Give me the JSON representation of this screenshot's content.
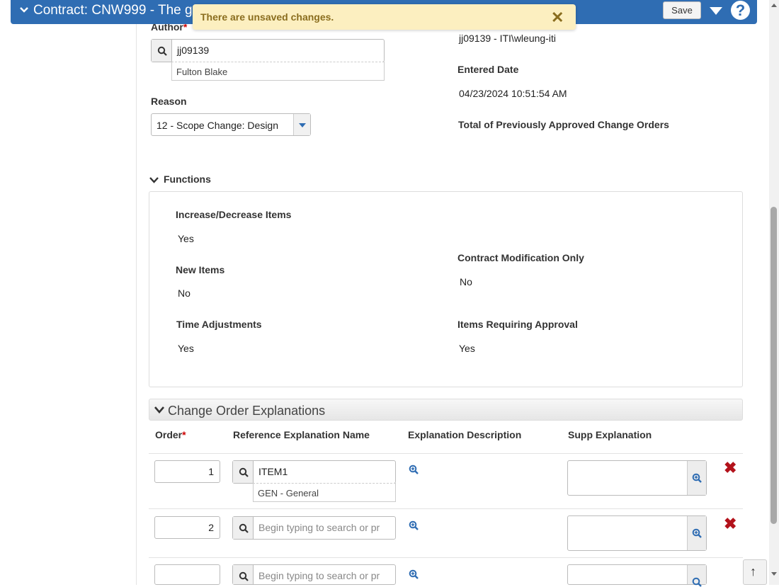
{
  "header": {
    "title": "Contract: CNW999 - The great",
    "save_label": "Save",
    "help_label": "?"
  },
  "toast": {
    "message": "There are unsaved changes.",
    "close": "✕"
  },
  "form": {
    "author_label": "Author",
    "author_value": "jj09139",
    "author_name": "Fulton Blake",
    "user_value": "jj09139 - ITI\\wleung-iti",
    "entered_date_label": "Entered Date",
    "entered_date_value": "04/23/2024 10:51:54 AM",
    "reason_label": "Reason",
    "reason_value": "12 - Scope Change: Design",
    "total_label": "Total of Previously Approved Change Orders"
  },
  "functions": {
    "title": "Functions",
    "increase_label": "Increase/Decrease Items",
    "increase_value": "Yes",
    "new_items_label": "New Items",
    "new_items_value": "No",
    "time_label": "Time Adjustments",
    "time_value": "Yes",
    "contract_mod_label": "Contract Modification Only",
    "contract_mod_value": "No",
    "approval_label": "Items Requiring Approval",
    "approval_value": "Yes"
  },
  "explanations": {
    "title": "Change Order Explanations",
    "columns": {
      "order": "Order",
      "ref": "Reference Explanation Name",
      "desc": "Explanation Description",
      "supp": "Supp Explanation"
    },
    "rows": [
      {
        "order": "1",
        "ref": "ITEM1",
        "ref_sub": "GEN - General"
      },
      {
        "order": "2",
        "ref_placeholder": "Begin typing to search or pr"
      },
      {
        "order": "",
        "ref_placeholder": "Begin typing to search or pr"
      }
    ]
  },
  "colors": {
    "brand": "#2f6db3",
    "toast_bg": "#fcefc0",
    "delete": "#b3121b"
  }
}
